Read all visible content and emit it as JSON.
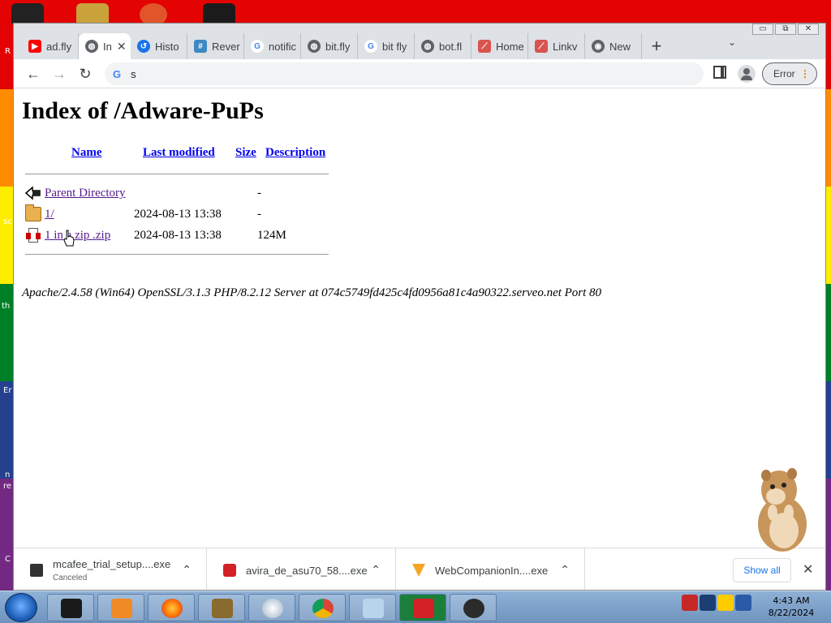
{
  "desktop": {
    "fragments": [
      "R",
      "sc",
      "th",
      "Er",
      "n",
      "re",
      "C"
    ]
  },
  "window_controls": [
    "▭",
    "⧉",
    "✕"
  ],
  "tabs": [
    {
      "label": "ad.fly",
      "icon": "youtube-icon",
      "color": "#ff0000"
    },
    {
      "label": "In",
      "icon": "globe-icon",
      "color": "#5f6368",
      "active": true,
      "close": "✕"
    },
    {
      "label": "Histo",
      "icon": "history-icon",
      "color": "#1a73e8"
    },
    {
      "label": "Rever",
      "icon": "hashtag-icon",
      "color": "#3b88c3"
    },
    {
      "label": "notific",
      "icon": "google-icon",
      "color": "#4285f4"
    },
    {
      "label": "bit.fly",
      "icon": "globe-icon",
      "color": "#5f6368"
    },
    {
      "label": "bit fly",
      "icon": "google-icon",
      "color": "#4285f4"
    },
    {
      "label": "bot.fl",
      "icon": "globe-icon",
      "color": "#5f6368"
    },
    {
      "label": "Home",
      "icon": "linkvertise-icon",
      "color": "#d9534f"
    },
    {
      "label": "Linkv",
      "icon": "linkvertise-icon",
      "color": "#d9534f"
    },
    {
      "label": "New",
      "icon": "chrome-icon",
      "color": "#5f6368"
    }
  ],
  "new_tab_label": "+",
  "tab_search_label": "⌄",
  "toolbar": {
    "back": "←",
    "forward": "→",
    "reload": "↻",
    "omnibox_prefix": "G",
    "omnibox_value": "s",
    "error_label": "Error",
    "menu_dots": "⋮"
  },
  "page": {
    "title": "Index of /Adware-PuPs",
    "columns": {
      "name": "Name",
      "last_modified": "Last modified",
      "size": "Size",
      "description": "Description"
    },
    "rows": [
      {
        "icon": "back-icon",
        "name": "Parent Directory",
        "date": "",
        "size": "-"
      },
      {
        "icon": "folder-icon",
        "name": "1/",
        "date": "2024-08-13 13:38",
        "size": "-"
      },
      {
        "icon": "zip-icon",
        "name": "1 in a zip .zip",
        "date": "2024-08-13 13:38",
        "size": "124M"
      }
    ],
    "server_line": "Apache/2.4.58 (Win64) OpenSSL/3.1.3 PHP/8.2.12 Server at 074c5749fd425c4fd0956a81c4a90322.serveo.net Port 80"
  },
  "downloads": [
    {
      "name": "mcafee_trial_setup....exe",
      "status": "Canceled",
      "icon_color": "#333333"
    },
    {
      "name": "avira_de_asu70_58....exe",
      "status": "",
      "icon_color": "#d42027"
    },
    {
      "name": "WebCompanionIn....exe",
      "status": "",
      "icon_color": "#f5a623"
    }
  ],
  "download_chevron": "⌃",
  "show_all_label": "Show all",
  "shelf_close": "✕",
  "taskbar": {
    "apps": [
      "terminal-icon",
      "media-player-icon",
      "firefox-icon",
      "game-box-icon",
      "disc-utility-icon",
      "chrome-icon",
      "notepad-icon",
      "avira-icon",
      "obs-icon"
    ],
    "time": "4:43 AM",
    "date": "8/22/2024"
  }
}
